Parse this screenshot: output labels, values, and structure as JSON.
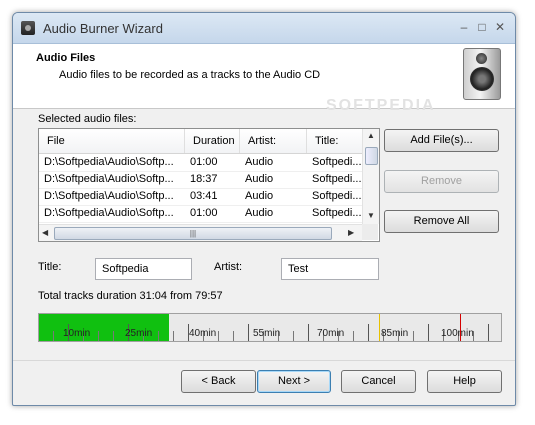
{
  "window": {
    "title": "Audio Burner Wizard"
  },
  "header": {
    "title": "Audio Files",
    "subtitle": "Audio files to be recorded as a tracks to the Audio CD"
  },
  "list": {
    "caption": "Selected audio files:",
    "columns": [
      "File",
      "Duration",
      "Artist:",
      "Title:"
    ],
    "rows": [
      {
        "file": "D:\\Softpedia\\Audio\\Softp...",
        "duration": "01:00",
        "artist": "Audio",
        "title": "Softpedi..."
      },
      {
        "file": "D:\\Softpedia\\Audio\\Softp...",
        "duration": "18:37",
        "artist": "Audio",
        "title": "Softpedi..."
      },
      {
        "file": "D:\\Softpedia\\Audio\\Softp...",
        "duration": "03:41",
        "artist": "Audio",
        "title": "Softpedi..."
      },
      {
        "file": "D:\\Softpedia\\Audio\\Softp...",
        "duration": "01:00",
        "artist": "Audio",
        "title": "Softpedi..."
      }
    ]
  },
  "side_buttons": {
    "add": "Add File(s)...",
    "remove": "Remove",
    "remove_all": "Remove All"
  },
  "fields": {
    "title_label": "Title:",
    "title_value": "Softpedia",
    "artist_label": "Artist:",
    "artist_value": "Test"
  },
  "duration": {
    "text": "Total tracks duration 31:04 from 79:57",
    "used_minutes": 31.07,
    "capacity_minutes": 79.95
  },
  "timeline": {
    "labels": [
      "10min",
      "25min",
      "40min",
      "55min",
      "70min",
      "85min",
      "100min"
    ],
    "fill_color": "#10c010"
  },
  "footer": {
    "back": "< Back",
    "next": "Next >",
    "cancel": "Cancel",
    "help": "Help"
  },
  "watermark": "SOFTPEDIA"
}
